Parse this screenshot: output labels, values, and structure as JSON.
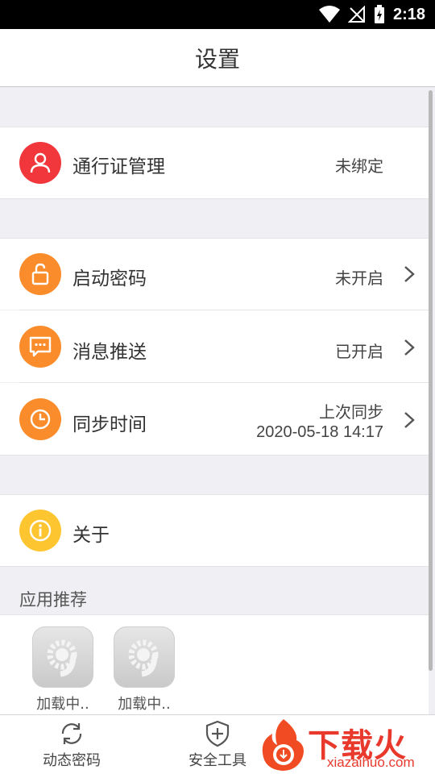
{
  "status_bar": {
    "time": "2:18"
  },
  "title": "设置",
  "account": {
    "label": "通行证管理",
    "value": "未绑定"
  },
  "settings": {
    "launch_password": {
      "label": "启动密码",
      "value": "未开启"
    },
    "push": {
      "label": "消息推送",
      "value": "已开启"
    },
    "sync": {
      "label": "同步时间",
      "value_line1": "上次同步",
      "value_line2": "2020-05-18 14:17"
    }
  },
  "about": {
    "label": "关于"
  },
  "recommend": {
    "title": "应用推荐",
    "apps": [
      {
        "label": "加载中.."
      },
      {
        "label": "加载中.."
      }
    ]
  },
  "bottom_nav": [
    {
      "label": "动态密码"
    },
    {
      "label": "安全工具"
    }
  ],
  "watermark": {
    "text": "下载火",
    "url": "xiazaihuo.com"
  },
  "colors": {
    "red": "#f1363c",
    "orange": "#fb8c2b",
    "yellow": "#fdc530"
  }
}
